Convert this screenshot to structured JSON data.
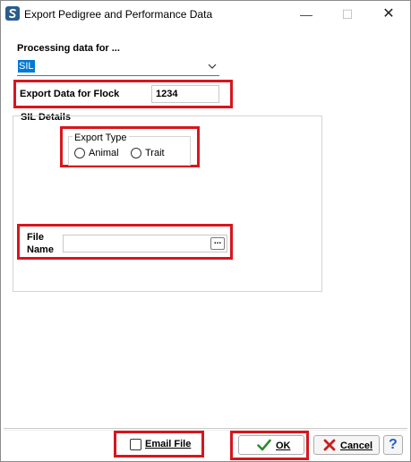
{
  "window": {
    "title": "Export Pedigree and Performance Data",
    "minimize_glyph": "—",
    "maximize_glyph": "☐",
    "close_glyph": "✕",
    "icon": "app-logo-icon"
  },
  "processing": {
    "label": "Processing data for ...",
    "selected": "SIL"
  },
  "flock": {
    "label": "Export Data for Flock",
    "value": "1234"
  },
  "sil_details": {
    "legend": "SIL Details",
    "export_type": {
      "legend": "Export Type",
      "options": [
        "Animal",
        "Trait"
      ]
    },
    "file_name": {
      "label_line1": "File",
      "label_line2": "Name",
      "value": "",
      "browse_label": "..."
    }
  },
  "footer": {
    "email_file_label": "Email File",
    "email_checked": false,
    "ok_label": "OK",
    "cancel_label": "Cancel",
    "help_label": "?"
  },
  "colors": {
    "highlight": "#d7161d",
    "selection": "#0078d7",
    "ok_check": "#2e8b2e",
    "cancel_x": "#c81e1e",
    "help": "#1f5fbf"
  }
}
